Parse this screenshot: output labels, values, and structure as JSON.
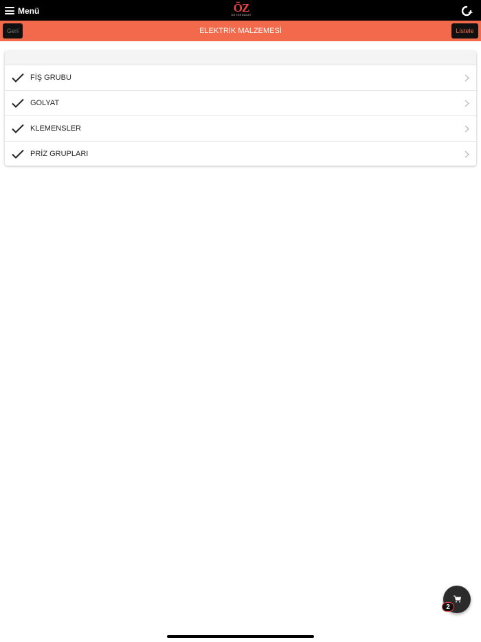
{
  "topbar": {
    "menu_label": "Menü",
    "logo_text": "ÖZ",
    "logo_subtext": "ÖZ HIRDAVAT",
    "menu_icon": "hamburger-icon",
    "refresh_icon": "refresh-icon"
  },
  "navbar": {
    "back_label": "Geri",
    "title": "ELEKTRİK MALZEMESİ",
    "list_label": "Listele",
    "bar_color": "#f26a4b"
  },
  "categories": [
    {
      "label": "FİŞ GRUBU",
      "icon": "check-icon"
    },
    {
      "label": "GOLYAT",
      "icon": "check-icon"
    },
    {
      "label": "KLEMENSLER",
      "icon": "check-icon"
    },
    {
      "label": "PRİZ GRUPLARI",
      "icon": "check-icon"
    }
  ],
  "cart": {
    "icon": "cart-icon",
    "badge_count": "2"
  }
}
